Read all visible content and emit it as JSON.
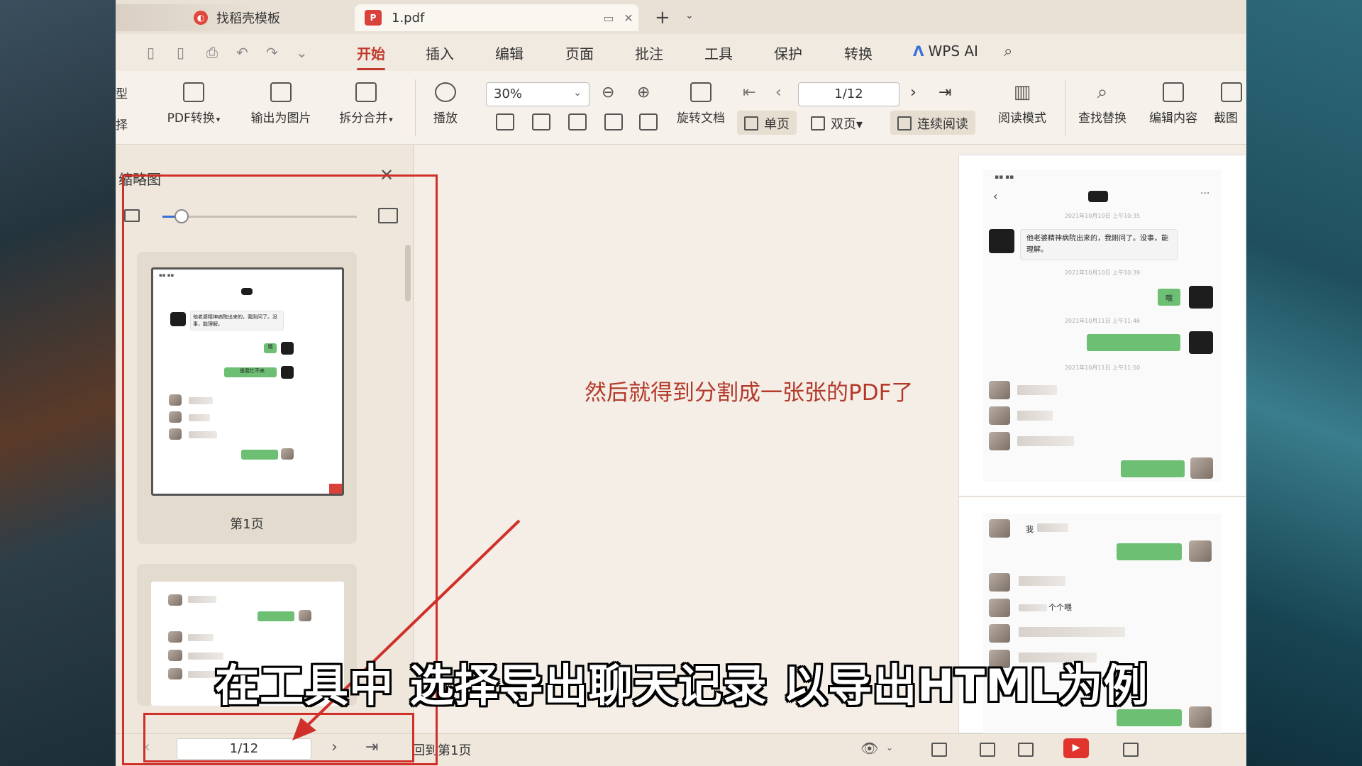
{
  "tabs": {
    "template_label": "找稻壳模板",
    "pdf_label": "1.pdf",
    "pdf_badge": "P"
  },
  "menu": {
    "items": [
      "开始",
      "插入",
      "编辑",
      "页面",
      "批注",
      "工具",
      "保护",
      "转换"
    ],
    "active": "开始",
    "ai_label": "WPS AI"
  },
  "ribbon": {
    "partial_left_top": "型",
    "partial_left_bottom": "择",
    "pdf_convert": "PDF转换",
    "export_image": "输出为图片",
    "split_merge": "拆分合并",
    "play": "播放",
    "zoom_value": "30%",
    "rotate_doc": "旋转文档",
    "single_page": "单页",
    "double_page": "双页",
    "continuous": "连续阅读",
    "page_value": "1/12",
    "read_mode": "阅读模式",
    "find_replace": "查找替换",
    "edit_content": "编辑内容",
    "screenshot_partial": "截图"
  },
  "thumbnail_panel": {
    "title": "缩略图",
    "slider_level": 0.1,
    "page1_label": "第1页"
  },
  "thumb_chat": {
    "msg1": "他老婆精神病院出来的，我刚问了。没事，能理解。",
    "reply": "哦",
    "green2": "是我忙不来"
  },
  "preview_chat": {
    "time1": "2021年10月10日 上午10:35",
    "msg1": "他老婆精神病院出来的，我刚问了。没事，能理解。",
    "time2": "2021年10月10日 上午10:39",
    "reply": "哦",
    "time3": "2021年10月11日 上午11:46",
    "time4": "2021年10月11日 上午11:50",
    "p2_msg1": "我",
    "p2_msg4": "个个喂"
  },
  "annotation": {
    "text": "然后就得到分割成一张张的PDF了"
  },
  "statusbar": {
    "page_value": "1/12",
    "back_first": "回到第1页"
  },
  "subtitle": {
    "text": "在工具中 选择导出聊天记录 以导出HTML为例"
  },
  "colors": {
    "accent_red": "#c0392b",
    "annotation_red": "#d0302a",
    "app_bg": "#f3ede4"
  }
}
